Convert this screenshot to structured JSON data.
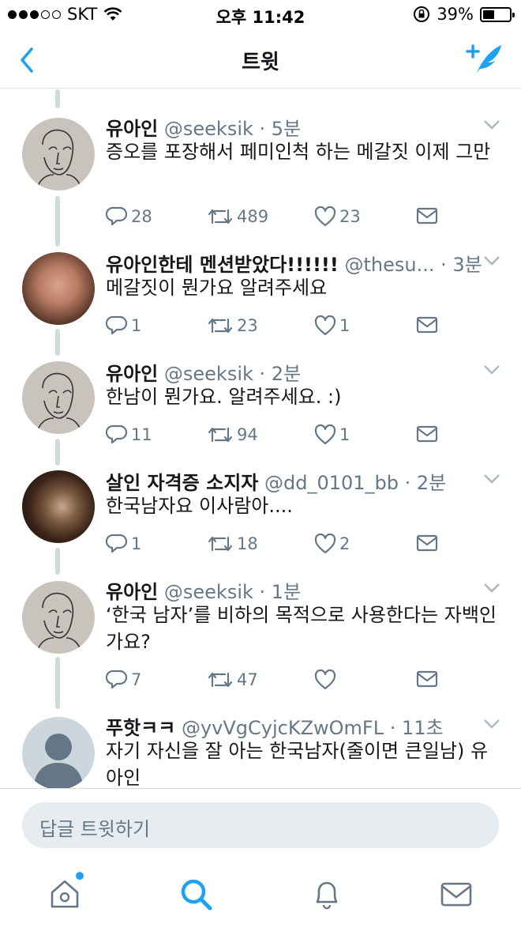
{
  "status": {
    "carrier": "SKT",
    "time": "오후 11:42",
    "battery": "39%",
    "battery_level": 0.39
  },
  "nav": {
    "title": "트윗",
    "back_icon": "chevron-left-icon",
    "compose_icon": "compose-tweet-icon"
  },
  "tweets": [
    {
      "name": "유아인",
      "handle": "@seeksik",
      "sep": " · ",
      "time": "5분",
      "text": "증오를 포장해서 페미인척 하는 메갈짓 이제 그만",
      "replies": "28",
      "retweets": "489",
      "likes": "23",
      "avatar": "sketch"
    },
    {
      "name": "유아인한테 멘션받았다!!!!!!",
      "handle": "@thesu...",
      "sep": " · ",
      "time": "3분",
      "text": "메갈짓이 뭔가요 알려주세요",
      "replies": "1",
      "retweets": "23",
      "likes": "1",
      "avatar": "photo1"
    },
    {
      "name": "유아인",
      "handle": "@seeksik",
      "sep": " · ",
      "time": "2분",
      "text": "한남이 뭔가요. 알려주세요. :)",
      "replies": "11",
      "retweets": "94",
      "likes": "1",
      "avatar": "sketch"
    },
    {
      "name": "살인 자격증 소지자",
      "handle": "@dd_0101_bb",
      "sep": " · ",
      "time": "2분",
      "text": "한국남자요 이사람아....",
      "replies": "1",
      "retweets": "18",
      "likes": "2",
      "avatar": "photo2"
    },
    {
      "name": "유아인",
      "handle": "@seeksik",
      "sep": " · ",
      "time": "1분",
      "text": "‘한국 남자’를 비하의 목적으로 사용한다는 자백인가요?",
      "replies": "7",
      "retweets": "47",
      "likes": "",
      "avatar": "sketch"
    },
    {
      "name": "푸핫ㅋㅋ",
      "handle": "@yvVgCyjcKZwOmFL",
      "sep": " · ",
      "time": "11초",
      "text": "자기 자신을 잘 아는 한국남자(줄이면 큰일남) 유아인",
      "avatar": "default"
    }
  ],
  "reply_bar": {
    "placeholder": "답글 트윗하기"
  },
  "tabbar": {
    "items": [
      "home-icon",
      "search-icon",
      "notifications-icon",
      "messages-icon"
    ],
    "accent": "#1da1f2"
  }
}
